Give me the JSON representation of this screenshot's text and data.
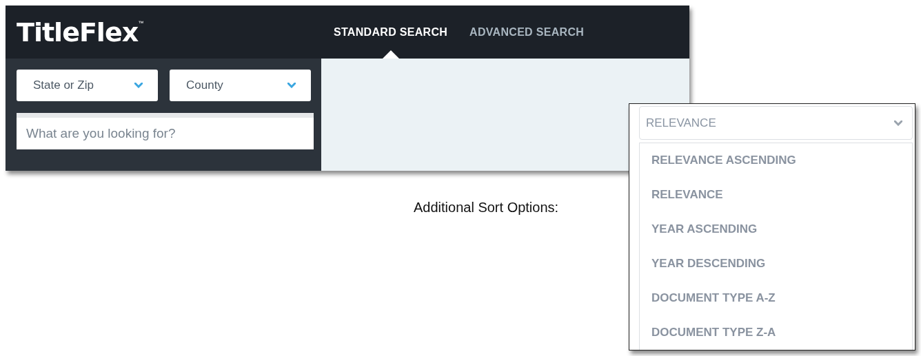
{
  "header": {
    "logo": "TitleFlex",
    "trademark": "™",
    "tabs": [
      {
        "label": "STANDARD SEARCH",
        "selected": true
      },
      {
        "label": "ADVANCED SEARCH",
        "selected": false
      }
    ]
  },
  "search": {
    "filters": [
      {
        "value": "State or Zip"
      },
      {
        "value": "County"
      }
    ],
    "query": {
      "placeholder": "What are you looking for?"
    }
  },
  "sort_label": "Additional Sort Options:",
  "sort": {
    "value": "RELEVANCE",
    "expanded": true,
    "options": [
      "RELEVANCE ASCENDING",
      "RELEVANCE",
      "YEAR ASCENDING",
      "YEAR DESCENDING",
      "DOCUMENT TYPE A-Z",
      "DOCUMENT TYPE Z-A"
    ]
  }
}
